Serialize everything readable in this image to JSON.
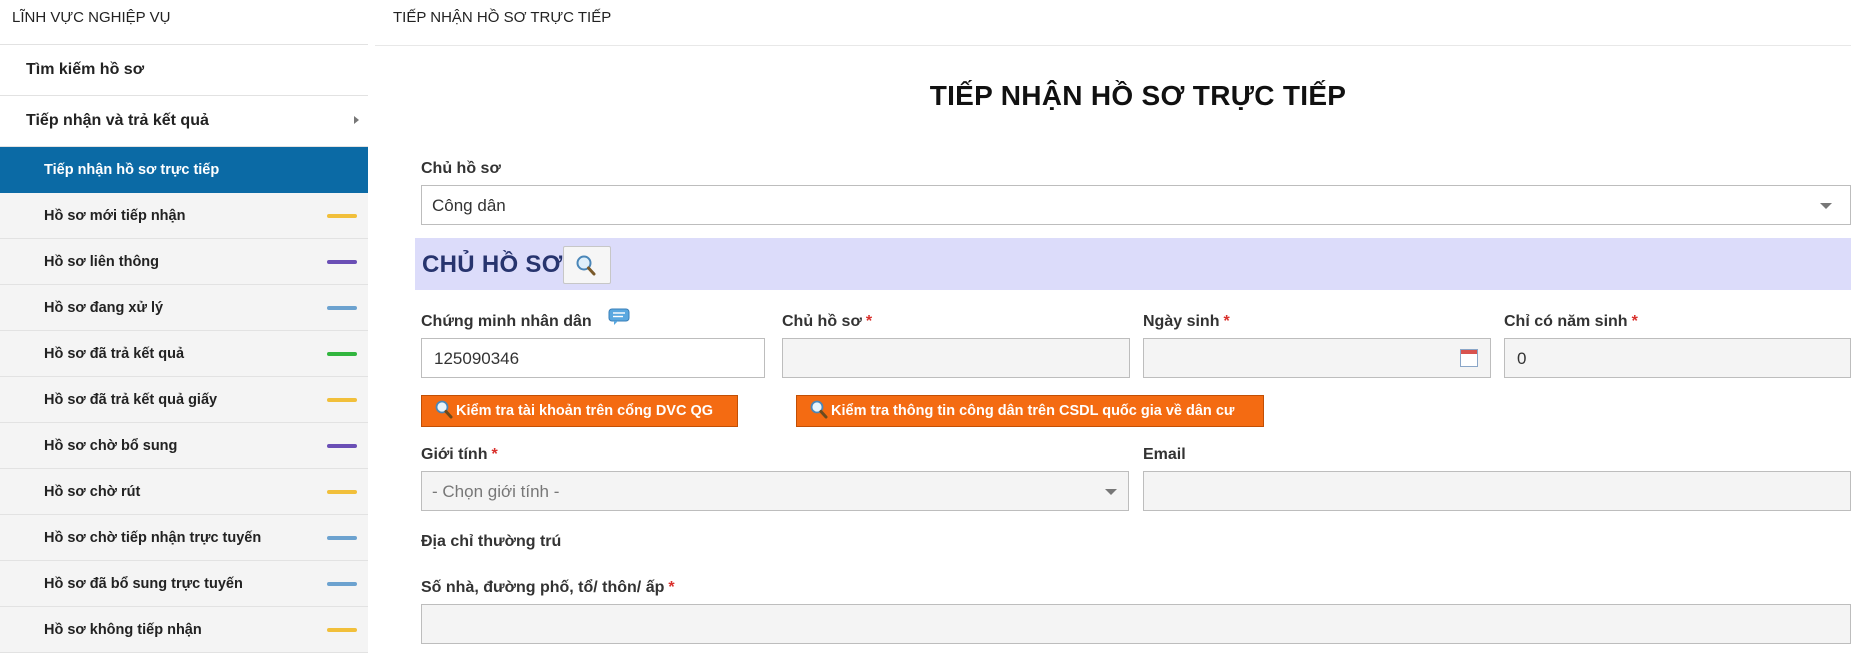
{
  "sidebar": {
    "title": "LĨNH VỰC NGHIỆP VỤ",
    "items": [
      {
        "label": "Tìm kiếm hồ sơ"
      },
      {
        "label": "Tiếp nhận và trả kết quả"
      }
    ],
    "sub_items": [
      {
        "label": "Tiếp nhận hồ sơ trực tiếp",
        "active": true
      },
      {
        "label": "Hồ sơ mới tiếp nhận",
        "color": "#f1bf3a"
      },
      {
        "label": "Hồ sơ liên thông",
        "color": "#6a4fb5"
      },
      {
        "label": "Hồ sơ đang xử lý",
        "color": "#6ca2cf"
      },
      {
        "label": "Hồ sơ đã trả kết quả",
        "color": "#31b53e"
      },
      {
        "label": "Hồ sơ đã trả kết quả giấy",
        "color": "#f1bf3a"
      },
      {
        "label": "Hồ sơ chờ bổ sung",
        "color": "#6a4fb5"
      },
      {
        "label": "Hồ sơ chờ rút",
        "color": "#f1bf3a"
      },
      {
        "label": "Hồ sơ chờ tiếp nhận trực tuyến",
        "color": "#6ca2cf"
      },
      {
        "label": "Hồ sơ đã bổ sung trực tuyến",
        "color": "#6ca2cf"
      },
      {
        "label": "Hồ sơ không tiếp nhận",
        "color": "#f1bf3a"
      }
    ]
  },
  "header": {
    "breadcrumb": "TIẾP NHẬN HỒ SƠ TRỰC TIẾP",
    "title": "TIẾP NHẬN HỒ SƠ TRỰC TIẾP"
  },
  "form": {
    "owner_type": {
      "label": "Chủ hồ sơ",
      "value": "Công dân"
    },
    "section_title": "CHỦ HỒ SƠ",
    "id_card": {
      "label": "Chứng minh nhân dân",
      "value": "125090346"
    },
    "owner_name": {
      "label": "Chủ hồ sơ",
      "required_mark": "*",
      "value": ""
    },
    "birth_date": {
      "label": "Ngày sinh",
      "required_mark": "*",
      "value": ""
    },
    "birth_year_only": {
      "label": "Chỉ có năm sinh",
      "required_mark": "*",
      "value": "0"
    },
    "check_account_button": "Kiểm tra tài khoản trên cổng DVC QG",
    "check_citizen_button": "Kiểm tra thông tin công dân trên CSDL quốc gia về dân cư",
    "gender": {
      "label": "Giới tính",
      "required_mark": "*",
      "placeholder": "- Chọn giới tính -"
    },
    "email": {
      "label": "Email",
      "value": ""
    },
    "address_heading": "Địa chỉ thường trú",
    "street": {
      "label": "Số nhà, đường phố, tổ/ thôn/ ấp",
      "required_mark": "*",
      "value": ""
    }
  },
  "colors": {
    "active_item_bg": "#0b6aa5",
    "section_bg": "#dcdcfa",
    "section_text": "#27346e",
    "action_button": "#f46b12",
    "required": "#d9302c"
  }
}
